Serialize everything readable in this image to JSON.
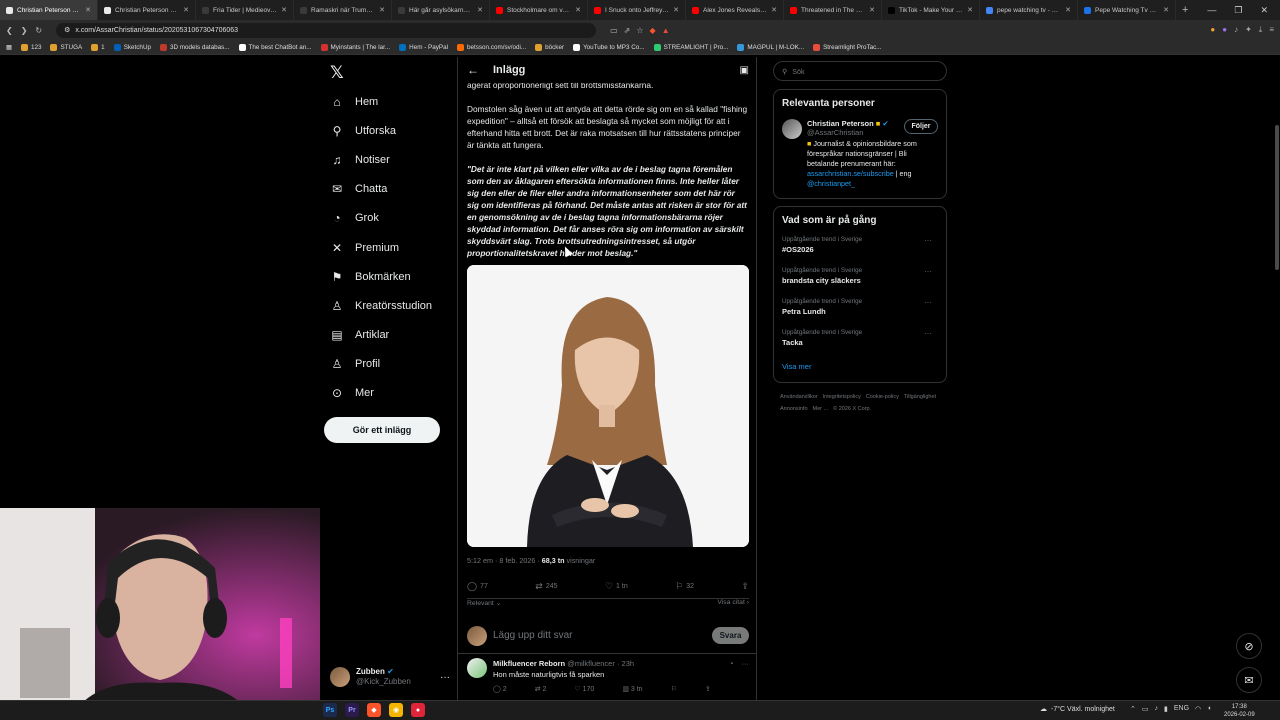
{
  "browser": {
    "tabs": [
      {
        "title": "Christian Peterson så på",
        "color": "#e7e9ea",
        "active": true
      },
      {
        "title": "Christian Peterson så (@As",
        "color": "#e7e9ea"
      },
      {
        "title": "Fria Tider | Medieoverige b",
        "color": "#3a3a3a"
      },
      {
        "title": "Ramaskri när Trump avbild",
        "color": "#3a3a3a"
      },
      {
        "title": "Här går asylsökarna till kniv",
        "color": "#3a3a3a"
      },
      {
        "title": "Stockholmare om varför la",
        "color": "#ff0000"
      },
      {
        "title": "I Snuck onto Jeffrey Epstein",
        "color": "#ff0000"
      },
      {
        "title": "Alex Jones Reveals EXACT",
        "color": "#ff0000"
      },
      {
        "title": "Threatened in The UK's Wa",
        "color": "#ff0000"
      },
      {
        "title": "TikTok - Make Your Day",
        "color": "#000000"
      },
      {
        "title": "pepe watching tv - Google",
        "color": "#4285f4"
      },
      {
        "title": "Pepe Watching Tv GIF - Pep",
        "color": "#1a73e8"
      }
    ],
    "url": "x.com/AssarChristian/status/2020531067304706063",
    "bookmarks": [
      {
        "label": "123",
        "color": "#e0a030"
      },
      {
        "label": "STUGA",
        "color": "#e0a030"
      },
      {
        "label": "1",
        "color": "#e0a030"
      },
      {
        "label": "SketchUp",
        "color": "#005fb8"
      },
      {
        "label": "3D models databas...",
        "color": "#c0392b"
      },
      {
        "label": "The best ChatBot an...",
        "color": "#ffffff"
      },
      {
        "label": "Myinstants | The lar...",
        "color": "#d63031"
      },
      {
        "label": "Hem - PayPal",
        "color": "#0070ba"
      },
      {
        "label": "betsson.com/sv/odi...",
        "color": "#ff6a00"
      },
      {
        "label": "böcker",
        "color": "#e0a030"
      },
      {
        "label": "YouTube to MP3 Co...",
        "color": "#ffffff"
      },
      {
        "label": "STREAMLIGHT | Pro...",
        "color": "#2ecc71"
      },
      {
        "label": "MAGPUL | M-LOK...",
        "color": "#3498db"
      },
      {
        "label": "Streamlight ProTac...",
        "color": "#e74c3c"
      }
    ]
  },
  "nav": {
    "items": [
      {
        "label": "Hem",
        "icon": "⌂"
      },
      {
        "label": "Utforska",
        "icon": "⚲"
      },
      {
        "label": "Notiser",
        "icon": "♫"
      },
      {
        "label": "Chatta",
        "icon": "✉"
      },
      {
        "label": "Grok",
        "icon": "◔"
      },
      {
        "label": "Premium",
        "icon": "✕"
      },
      {
        "label": "Bokmärken",
        "icon": "⚑"
      },
      {
        "label": "Kreatörsstudion",
        "icon": "♙"
      },
      {
        "label": "Artiklar",
        "icon": "▤"
      },
      {
        "label": "Profil",
        "icon": "♙"
      },
      {
        "label": "Mer",
        "icon": "⊙"
      }
    ],
    "post_button": "Gör ett inlägg",
    "account": {
      "name": "Zubben",
      "handle": "@Kick_Zubben"
    }
  },
  "post": {
    "header_title": "Inlägg",
    "cut_line": "agerat oproportionerligt sett till brottsmisstankarna.",
    "paragraph1": "Domstolen såg även ut att antyda att detta rörde sig om en så kallad \"fishing expedition\" – alltså ett försök att beslagta så mycket som möjligt för att i efterhand hitta ett brott. Det är raka motsatsen till hur rättsstatens principer är tänkta att fungera.",
    "paragraph2": "\"Det är inte klart på vilken eller vilka av de i beslag tagna föremålen som den av åklagaren eftersökta informationen finns. Inte heller låter sig den eller de filer eller andra informationsenheter som det här rör sig om identifieras på förhand. Det måste antas att risken är stor för att en genomsökning av de i beslag tagna informationsbärarna röjer skyddad information. Det får anses röra sig om information av särskilt skyddsvärt slag. Trots brottsutredningsintresset, så utgör proportionalitetskravet hinder mot beslag.\"",
    "time": "5:12 em · 8 feb. 2026 ·",
    "views": "68,3 tn",
    "views_label": "visningar",
    "stats": {
      "replies": "77",
      "reposts": "245",
      "likes": "1 tn",
      "bookmarks": "32"
    },
    "sort_label": "Relevant",
    "quotes_label": "Visa citat",
    "reply_placeholder": "Lägg upp ditt svar",
    "reply_button": "Svara"
  },
  "comment": {
    "name": "Milkfluencer Reborn",
    "handle": "@milkfluencer",
    "time": "· 23h",
    "text": "Hon måste naturligtvis få sparken",
    "stats": {
      "replies": "2",
      "reposts": "2",
      "likes": "170",
      "views": "3 tn"
    }
  },
  "sidebar": {
    "search_placeholder": "Sök",
    "people_title": "Relevanta personer",
    "person": {
      "name": "Christian Peterson",
      "handle": "@AssarChristian",
      "follow_label": "Följer",
      "bio": "Journalist & opinionsbildare som förespråkar nationsgränser | Bli betalande prenumerant här:",
      "bio_link": "assarchristian.se/subscribe",
      "bio_tail": "| eng",
      "bio_handle": "@christianpet_"
    },
    "trends_title": "Vad som är på gång",
    "trends": [
      {
        "context": "Uppåtgående trend i Sverige",
        "name": "#OS2026"
      },
      {
        "context": "Uppåtgående trend i Sverige",
        "name": "brandsta city släckers"
      },
      {
        "context": "Uppåtgående trend i Sverige",
        "name": "Petra Lundh"
      },
      {
        "context": "Uppåtgående trend i Sverige",
        "name": "Tacka"
      }
    ],
    "show_more": "Visa mer",
    "footer": [
      "Användarvillkor",
      "Integritetspolicy",
      "Cookie-policy",
      "Tillgänglighet",
      "Annonsinfo",
      "Mer ...",
      "© 2026 X Corp."
    ]
  },
  "taskbar": {
    "weather": "-7°C  Växl. molnighet",
    "lang": "ENG",
    "time": "17:38",
    "date": "2026-02-09"
  },
  "colors": {
    "accent": "#1d9bf0",
    "bg": "#000000",
    "border": "#2f3336"
  }
}
